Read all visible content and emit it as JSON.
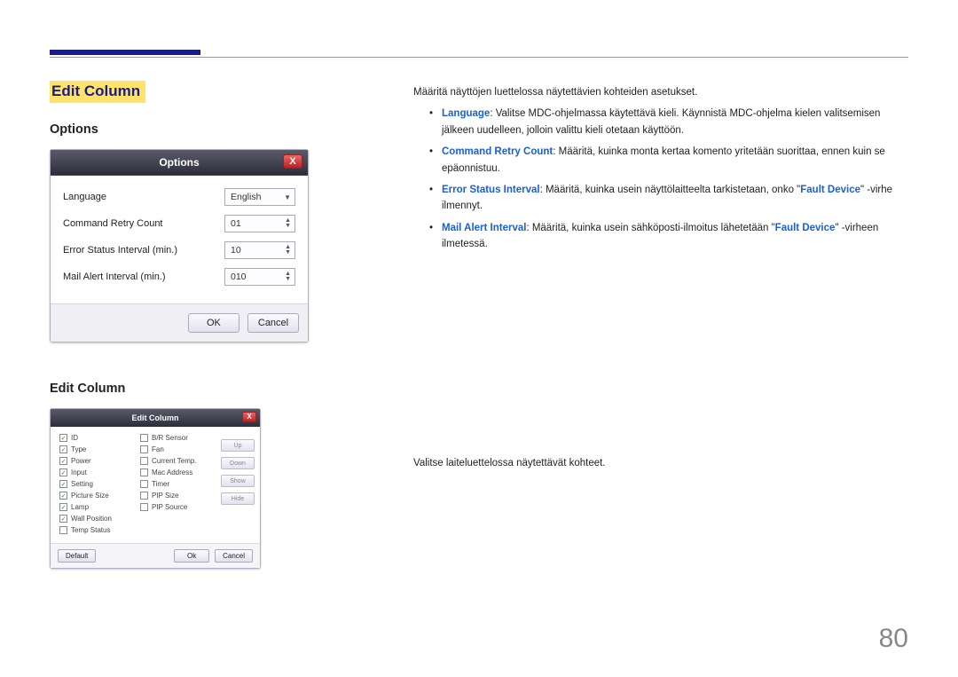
{
  "page_number": "80",
  "heading": "Edit Column",
  "options_section": {
    "title": "Options",
    "dialog_title": "Options",
    "close": "X",
    "rows": {
      "language_label": "Language",
      "language_value": "English",
      "retry_label": "Command Retry Count",
      "retry_value": "01",
      "error_label": "Error Status Interval (min.)",
      "error_value": "10",
      "mail_label": "Mail Alert Interval (min.)",
      "mail_value": "010"
    },
    "ok": "OK",
    "cancel": "Cancel",
    "description_intro": "Määritä näyttöjen luettelossa näytettävien kohteiden asetukset.",
    "bullets": {
      "b1_key": "Language",
      "b1_text": ": Valitse MDC-ohjelmassa käytettävä kieli. Käynnistä MDC-ohjelma kielen valitsemisen jälkeen uudelleen, jolloin valittu kieli otetaan käyttöön.",
      "b2_key": "Command Retry Count",
      "b2_text": ": Määritä, kuinka monta kertaa komento yritetään suorittaa, ennen kuin se epäonnistuu.",
      "b3_key": "Error Status Interval",
      "b3_text_a": ": Määritä, kuinka usein näyttölaitteelta tarkistetaan, onko \"",
      "b3_fault": "Fault Device",
      "b3_text_b": "\" -virhe ilmennyt.",
      "b4_key": "Mail Alert Interval",
      "b4_text_a": ": Määritä, kuinka usein sähköposti-ilmoitus lähetetään \"",
      "b4_fault": "Fault Device",
      "b4_text_b": "\" -virheen ilmetessä."
    }
  },
  "editcol_section": {
    "title": "Edit Column",
    "dialog_title": "Edit Column",
    "close": "X",
    "description": "Valitse laiteluettelossa näytettävät kohteet.",
    "col1": [
      "ID",
      "Type",
      "Power",
      "Input",
      "Setting",
      "Picture Size",
      "Lamp",
      "Wall Position",
      "Temp Status"
    ],
    "col1_checked": [
      true,
      true,
      true,
      true,
      true,
      true,
      true,
      true,
      false
    ],
    "col2": [
      "B/R Sensor",
      "Fan",
      "Current Temp.",
      "Mac Address",
      "Timer",
      "PIP Size",
      "PIP Source"
    ],
    "col2_checked": [
      false,
      false,
      false,
      false,
      false,
      false,
      false
    ],
    "sidebtns": [
      "Up",
      "Down",
      "Show",
      "Hide"
    ],
    "default": "Default",
    "ok": "Ok",
    "cancel": "Cancel"
  }
}
